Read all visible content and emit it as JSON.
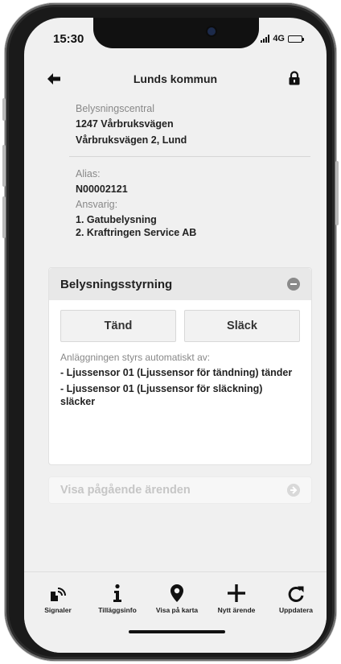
{
  "status_bar": {
    "time": "15:30",
    "network": "4G"
  },
  "nav": {
    "title": "Lunds kommun",
    "back_icon": "arrow-left-icon",
    "lock_icon": "lock-icon"
  },
  "info": {
    "central_label": "Belysningscentral",
    "central_name": "1247 Vårbruksvägen",
    "address": "Vårbruksvägen 2, Lund",
    "alias_label": "Alias:",
    "alias_value": "N00002121",
    "responsible_label": "Ansvarig:",
    "responsible": [
      "1. Gatubelysning",
      "2. Kraftringen Service AB"
    ]
  },
  "lighting_control": {
    "title": "Belysningsstyrning",
    "on_button": "Tänd",
    "off_button": "Släck",
    "auto_label": "Anläggningen styrs automatiskt av:",
    "auto_items": [
      "- Ljussensor 01 (Ljussensor för tändning) tänder",
      "- Ljussensor 01 (Ljussensor för släckning) släcker"
    ]
  },
  "pending": {
    "label": "Visa pågående ärenden"
  },
  "tabbar": {
    "items": [
      {
        "label": "Signaler",
        "icon": "signal-icon"
      },
      {
        "label": "Tilläggsinfo",
        "icon": "info-icon"
      },
      {
        "label": "Visa på karta",
        "icon": "map-pin-icon"
      },
      {
        "label": "Nytt ärende",
        "icon": "plus-icon"
      },
      {
        "label": "Uppdatera",
        "icon": "refresh-icon"
      }
    ]
  },
  "colors": {
    "background": "#f0f0f0",
    "card": "#ffffff",
    "header": "#e8e8e8",
    "muted_text": "#888888",
    "disabled_text": "#c6c6c6"
  }
}
